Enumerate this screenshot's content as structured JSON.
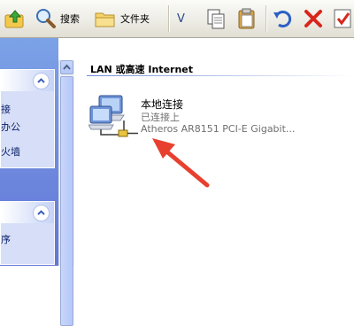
{
  "toolbar": {
    "search_label": "搜索",
    "folders_label": "文件夹",
    "views_label": "V"
  },
  "sidebar": {
    "group1_items": [
      "接",
      "办公",
      "火墙"
    ],
    "group2_items": [
      "序"
    ]
  },
  "main": {
    "group_title": "LAN 或高速 Internet",
    "connection": {
      "name": "本地连接",
      "status": "已连接上",
      "device": "Atheros AR8151 PCI-E Gigabit..."
    }
  },
  "colors": {
    "accent_arrow": "#e8402f",
    "pane_blue": "#6f8fe0"
  }
}
